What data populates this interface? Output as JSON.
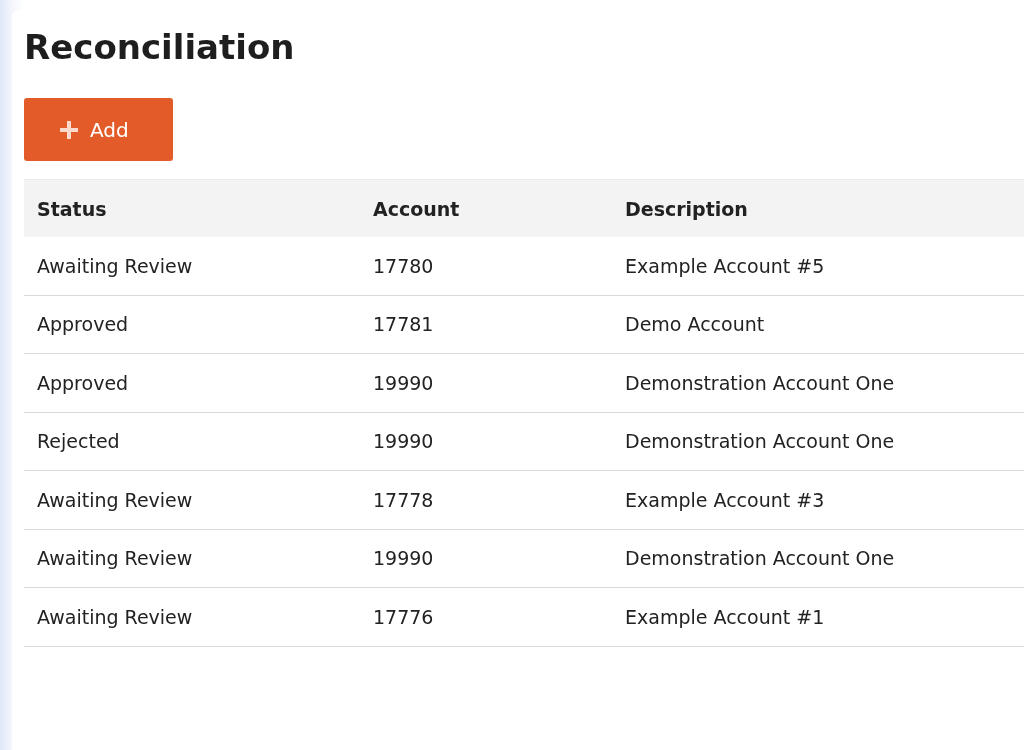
{
  "page": {
    "title": "Reconciliation"
  },
  "add_button": {
    "label": "Add"
  },
  "table": {
    "columns": [
      "Status",
      "Account",
      "Description"
    ],
    "rows": [
      {
        "status": "Awaiting Review",
        "account": "17780",
        "description": "Example Account #5"
      },
      {
        "status": "Approved",
        "account": "17781",
        "description": "Demo Account"
      },
      {
        "status": "Approved",
        "account": "19990",
        "description": "Demonstration Account One"
      },
      {
        "status": "Rejected",
        "account": "19990",
        "description": "Demonstration Account One"
      },
      {
        "status": "Awaiting Review",
        "account": "17778",
        "description": "Example Account #3"
      },
      {
        "status": "Awaiting Review",
        "account": "19990",
        "description": "Demonstration Account One"
      },
      {
        "status": "Awaiting Review",
        "account": "17776",
        "description": "Example Account #1"
      }
    ]
  }
}
